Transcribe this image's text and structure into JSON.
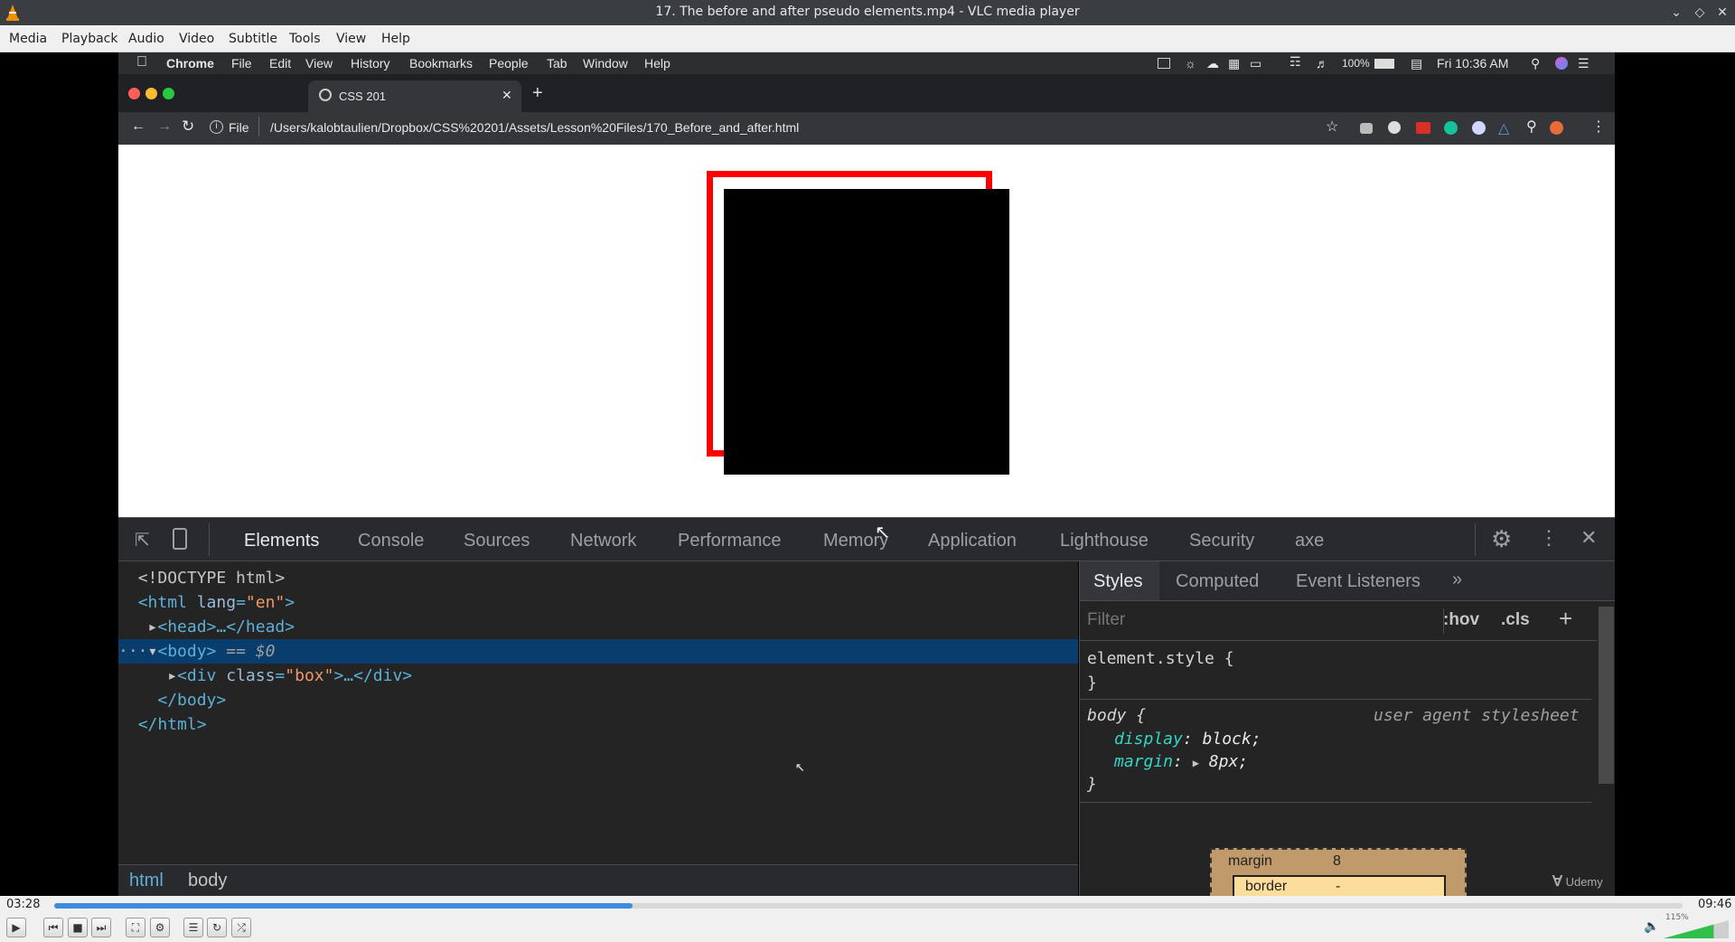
{
  "window": {
    "title": "17. The before and after pseudo elements.mp4 - VLC media player",
    "buttons": [
      "minimize",
      "maximize",
      "close"
    ]
  },
  "menu": [
    "Media",
    "Playback",
    "Audio",
    "Video",
    "Subtitle",
    "Tools",
    "View",
    "Help"
  ],
  "mac_menu": {
    "items": [
      "Chrome",
      "File",
      "Edit",
      "View",
      "History",
      "Bookmarks",
      "People",
      "Tab",
      "Window",
      "Help"
    ],
    "battery": "100%",
    "clock": "Fri 10:36 AM"
  },
  "browser": {
    "tab_title": "CSS 201",
    "file_label": "File",
    "url": "/Users/kalobtaulien/Dropbox/CSS%20201/Assets/Lesson%20Files/170_Before_and_after.html"
  },
  "devtools": {
    "tabs": [
      "Elements",
      "Console",
      "Sources",
      "Network",
      "Performance",
      "Memory",
      "Application",
      "Lighthouse",
      "Security",
      "axe"
    ],
    "dom": {
      "doctype": "<!DOCTYPE html>",
      "html_open": "<html",
      "lang_attr": "lang",
      "lang_val": "\"en\"",
      "close_bracket": ">",
      "head": "<head>…</head>",
      "body_open": "<body>",
      "body_marker": " == $0",
      "div_open": "<div",
      "class_attr": "class",
      "class_val": "\"box\"",
      "div_rest": ">…</div>",
      "body_close": "</body>",
      "html_close": "</html>",
      "ellipsis": "···"
    },
    "breadcrumbs": [
      "html",
      "body"
    ],
    "styles_tabs": [
      "Styles",
      "Computed",
      "Event Listeners",
      "»"
    ],
    "filter_placeholder": "Filter",
    "hov": ":hov",
    "cls": ".cls",
    "plus": "+",
    "rules": {
      "element_style_open": "element.style {",
      "close_brace": "}",
      "body_selector": "body {",
      "ua_label": "user agent stylesheet",
      "display_prop": "display",
      "display_val": "block;",
      "margin_prop": "margin",
      "margin_val": "8px;"
    },
    "box_model": {
      "margin_label": "margin",
      "margin_value": "8",
      "border_label": "border",
      "border_value": "-"
    }
  },
  "watermark": "Udemy",
  "player": {
    "elapsed": "03:28",
    "total": "09:46",
    "progress": 0.355,
    "volume_label": "115%",
    "volume": 0.77
  },
  "colors": {
    "highlight_row": "#083d6d",
    "progress_fill": "#3c8de0",
    "demo_outline": "#ff0000",
    "volume_fill": "#2fbf4a"
  }
}
